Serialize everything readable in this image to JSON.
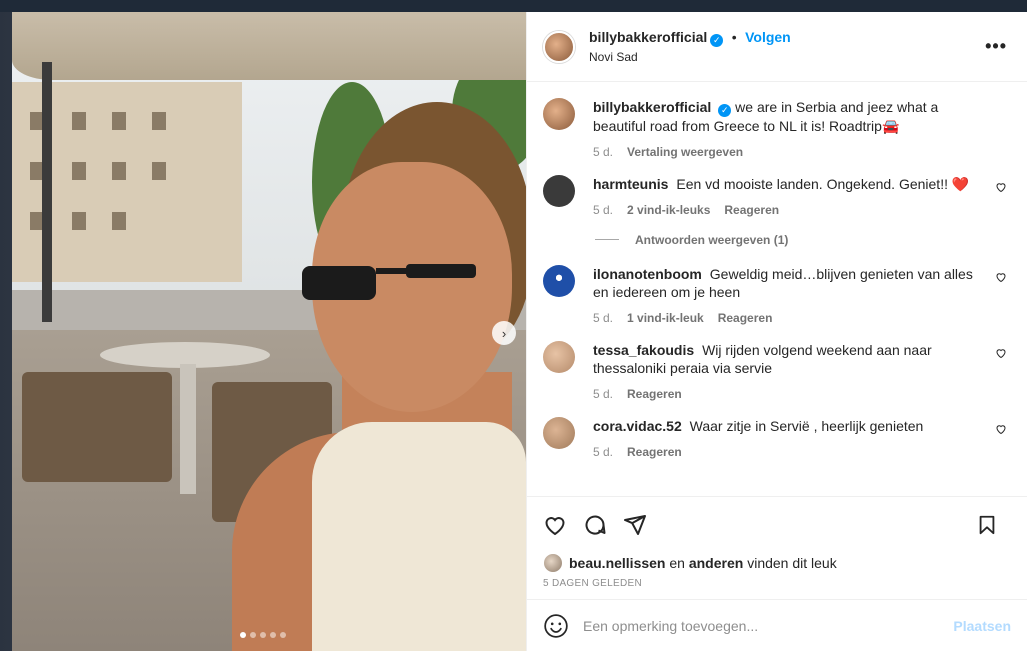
{
  "post": {
    "username": "billybakkerofficial",
    "follow_label": "Volgen",
    "bullet": "•",
    "location": "Novi Sad",
    "verified_glyph": "✓"
  },
  "caption": {
    "username": "billybakkerofficial",
    "text": "we are in Serbia and jeez what a beautiful road from Greece to NL it is! Roadtrip🚘",
    "age": "5 d.",
    "translate_label": "Vertaling weergeven"
  },
  "comments": [
    {
      "username": "harmteunis",
      "text": "Een vd mooiste landen. Ongekend. Geniet!! ❤️",
      "age": "5 d.",
      "likes": "2 vind-ik-leuks",
      "reply_label": "Reageren",
      "avatar_color": "#3a3a3a"
    },
    {
      "username": "ilonanotenboom",
      "text": "Geweldig meid…blijven genieten van alles en iedereen om je heen",
      "age": "5 d.",
      "likes": "1 vind-ik-leuk",
      "reply_label": "Reageren",
      "avatar_color": "#1f4fa8"
    },
    {
      "username": "tessa_fakoudis",
      "text": "Wij rijden volgend weekend aan naar thessaloniki peraia via servie",
      "age": "5 d.",
      "likes": "",
      "reply_label": "Reageren",
      "avatar_color": "#b48a6a"
    },
    {
      "username": "cora.vidac.52",
      "text": "Waar zitje in Servië , heerlijk genieten",
      "age": "5 d.",
      "likes": "",
      "reply_label": "Reageren",
      "avatar_color": "#a07a5a"
    }
  ],
  "replies_label": "Antwoorden weergeven (1)",
  "likes": {
    "first_user": "beau.nellissen",
    "connector": "en",
    "others": "anderen",
    "suffix": "vinden dit leuk"
  },
  "date_label": "5 DAGEN GELEDEN",
  "comment_box": {
    "placeholder": "Een opmerking toevoegen...",
    "post_label": "Plaatsen"
  },
  "photo": {
    "next_glyph": "›",
    "dot_count": 5,
    "active_dot": 1
  },
  "more_glyph": "•••",
  "colors": {
    "accent": "#0095f6",
    "post_disabled": "#b3dbff"
  }
}
